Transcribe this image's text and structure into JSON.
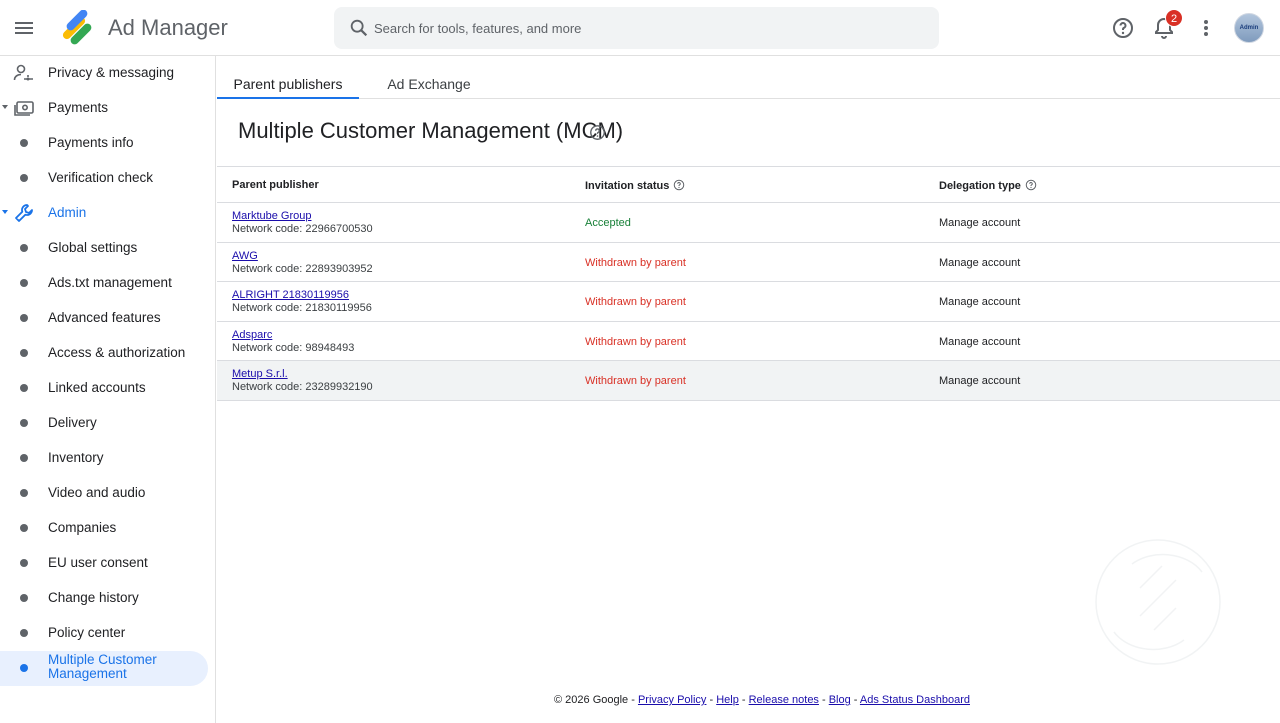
{
  "header": {
    "app_title": "Ad Manager",
    "search_placeholder": "Search for tools, features, and more",
    "notification_count": "2",
    "avatar_text": "Admin"
  },
  "sidebar": {
    "items": [
      {
        "label": "Privacy & messaging"
      },
      {
        "label": "Payments"
      },
      {
        "label": "Payments info"
      },
      {
        "label": "Verification check"
      },
      {
        "label": "Admin"
      },
      {
        "label": "Global settings"
      },
      {
        "label": "Ads.txt management"
      },
      {
        "label": "Advanced features"
      },
      {
        "label": "Access & authorization"
      },
      {
        "label": "Linked accounts"
      },
      {
        "label": "Delivery"
      },
      {
        "label": "Inventory"
      },
      {
        "label": "Video and audio"
      },
      {
        "label": "Companies"
      },
      {
        "label": "EU user consent"
      },
      {
        "label": "Change history"
      },
      {
        "label": "Policy center"
      },
      {
        "label": "Multiple Customer Management"
      }
    ]
  },
  "tabs": [
    {
      "label": "Parent publishers"
    },
    {
      "label": "Ad Exchange"
    }
  ],
  "page": {
    "title": "Multiple Customer Management (MCM)"
  },
  "table": {
    "columns": [
      "Parent publisher",
      "Invitation status",
      "Delegation type"
    ],
    "rows": [
      {
        "name": "Marktube Group",
        "code": "Network code: 22966700530",
        "status": "Accepted",
        "delegation": "Manage account"
      },
      {
        "name": "AWG",
        "code": "Network code: 22893903952",
        "status": "Withdrawn by parent",
        "delegation": "Manage account"
      },
      {
        "name": "ALRIGHT 21830119956",
        "code": "Network code: 21830119956",
        "status": "Withdrawn by parent",
        "delegation": "Manage account"
      },
      {
        "name": "Adsparc",
        "code": "Network code: 98948493",
        "status": "Withdrawn by parent",
        "delegation": "Manage account"
      },
      {
        "name": "Metup S.r.l.",
        "code": "Network code: 23289932190",
        "status": "Withdrawn by parent",
        "delegation": "Manage account"
      }
    ]
  },
  "footer": {
    "copyright": "© 2026 Google",
    "sep": " - ",
    "links": [
      "Privacy Policy",
      "Help",
      "Release notes",
      "Blog",
      "Ads Status Dashboard"
    ]
  },
  "colors": {
    "accent": "#1a73e8",
    "accepted": "#188038",
    "withdrawn": "#d93025",
    "link": "#1a0dab"
  },
  "icons": [
    "menu-icon",
    "ad-manager-logo",
    "search-icon",
    "help-icon",
    "bell-icon",
    "more-vert-icon",
    "privacy-icon",
    "payments-icon",
    "admin-wrench-icon"
  ]
}
